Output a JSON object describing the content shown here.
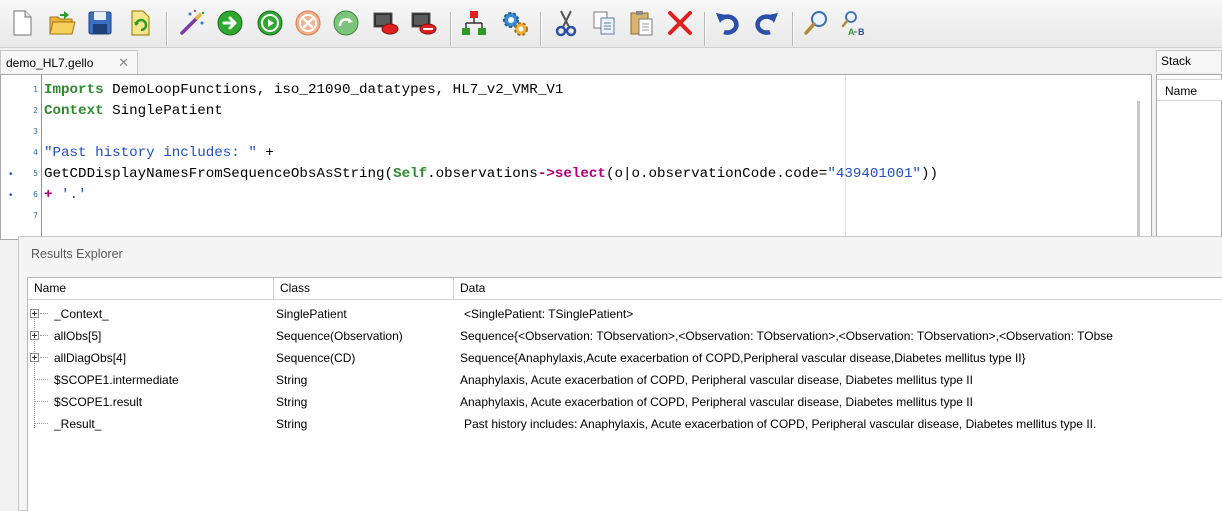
{
  "toolbar": {
    "buttons": [
      {
        "name": "new-file-icon"
      },
      {
        "name": "open-folder-icon"
      },
      {
        "name": "save-icon"
      },
      {
        "name": "reopen-icon"
      },
      {
        "name": "magic-wand-icon"
      },
      {
        "name": "go-icon"
      },
      {
        "name": "run-icon"
      },
      {
        "name": "stop-icon"
      },
      {
        "name": "step-over-icon"
      },
      {
        "name": "breakpoint-icon"
      },
      {
        "name": "clear-breakpoints-icon"
      },
      {
        "name": "hierarchy-icon"
      },
      {
        "name": "settings-gears-icon"
      },
      {
        "name": "cut-icon"
      },
      {
        "name": "copy-icon"
      },
      {
        "name": "paste-icon"
      },
      {
        "name": "delete-icon"
      },
      {
        "name": "undo-icon"
      },
      {
        "name": "redo-icon"
      },
      {
        "name": "find-icon"
      },
      {
        "name": "replace-icon"
      }
    ]
  },
  "editor": {
    "tab_label": "demo_HL7.gello",
    "tab_close": "✕",
    "line_numbers": [
      "1",
      "2",
      "3",
      "4",
      "5",
      "6",
      "7"
    ],
    "breakpoint_marker": "•"
  },
  "code": {
    "l1_kw": "Imports",
    "l1_rest": " DemoLoopFunctions, iso_21090_datatypes, HL7_v2_VMR_V1",
    "l2_kw": "Context",
    "l2_rest": " SinglePatient",
    "l4_str": "\"Past history includes: \"",
    "l4_rest": " +",
    "l5_a": "GetCDDisplayNamesFromSequenceObsAsString(",
    "l5_self": "Self",
    "l5_b": ".observations",
    "l5_op": "->select",
    "l5_c": "(o|o.observationCode.code=",
    "l5_str": "\"439401001\"",
    "l5_d": "))",
    "l6_a": "+ ",
    "l6_str": "'.'"
  },
  "stack": {
    "title": "Stack",
    "column": "Name"
  },
  "results": {
    "title": "Results Explorer",
    "columns": {
      "name": "Name",
      "class": "Class",
      "data": "Data"
    },
    "rows": [
      {
        "name": "_Context_",
        "class": "SinglePatient",
        "data": "<SinglePatient: TSinglePatient>"
      },
      {
        "name": "allObs[5]",
        "class": "Sequence(Observation)",
        "data": "Sequence{<Observation: TObservation>,<Observation: TObservation>,<Observation: TObservation>,<Observation: TObse"
      },
      {
        "name": "allDiagObs[4]",
        "class": "Sequence(CD)",
        "data": "Sequence{Anaphylaxis,Acute exacerbation of COPD,Peripheral vascular disease,Diabetes mellitus type II}"
      },
      {
        "name": "$SCOPE1.intermediate",
        "class": "String",
        "data": " Anaphylaxis, Acute exacerbation of COPD, Peripheral vascular disease, Diabetes mellitus type II"
      },
      {
        "name": "$SCOPE1.result",
        "class": "String",
        "data": " Anaphylaxis, Acute exacerbation of COPD, Peripheral vascular disease, Diabetes mellitus type II"
      },
      {
        "name": "_Result_",
        "class": "String",
        "data": "Past history includes:  Anaphylaxis, Acute exacerbation of COPD, Peripheral vascular disease, Diabetes mellitus type II."
      }
    ]
  }
}
